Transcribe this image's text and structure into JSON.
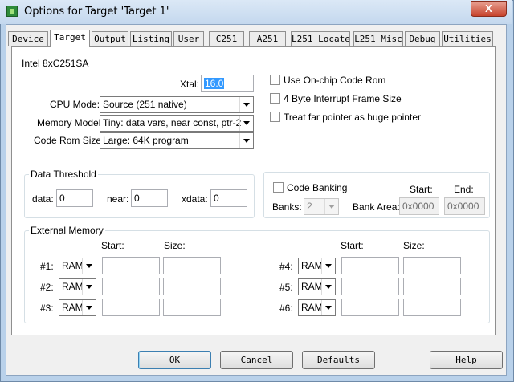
{
  "window": {
    "title": "Options for Target 'Target 1'",
    "close_glyph": "X"
  },
  "tabs": [
    {
      "label": "Device"
    },
    {
      "label": "Target"
    },
    {
      "label": "Output"
    },
    {
      "label": "Listing"
    },
    {
      "label": "User"
    },
    {
      "label": "C251"
    },
    {
      "label": "A251"
    },
    {
      "label": "L251 Locate"
    },
    {
      "label": "L251 Misc"
    },
    {
      "label": "Debug"
    },
    {
      "label": "Utilities"
    }
  ],
  "active_tab": "Target",
  "device_name": "Intel 8xC251SA",
  "xtal": {
    "label": "Xtal:",
    "value": "16.0"
  },
  "cpu_mode": {
    "label": "CPU Mode:",
    "value": "Source (251 native)"
  },
  "memory_model": {
    "label": "Memory Model:",
    "value": "Tiny: data vars, near const, ptr-2"
  },
  "code_rom_size": {
    "label": "Code Rom Size:",
    "value": "Large: 64K program"
  },
  "options": [
    {
      "label": "Use On-chip Code Rom",
      "checked": false
    },
    {
      "label": "4 Byte Interrupt Frame Size",
      "checked": false
    },
    {
      "label": "Treat far pointer as huge pointer",
      "checked": false
    }
  ],
  "data_threshold": {
    "title": "Data Threshold",
    "data_label": "data:",
    "data_value": "0",
    "near_label": "near:",
    "near_value": "0",
    "xdata_label": "xdata:",
    "xdata_value": "0"
  },
  "code_banking": {
    "label": "Code Banking",
    "checked": false,
    "banks_label": "Banks:",
    "banks_value": "2",
    "bank_area_label": "Bank Area:",
    "start_label": "Start:",
    "start_value": "0x0000",
    "end_label": "End:",
    "end_value": "0x0000"
  },
  "external_memory": {
    "title": "External Memory",
    "start_label": "Start:",
    "size_label": "Size:",
    "rows": [
      {
        "label": "#1:",
        "type": "RAM",
        "start": "",
        "size": ""
      },
      {
        "label": "#2:",
        "type": "RAM",
        "start": "",
        "size": ""
      },
      {
        "label": "#3:",
        "type": "RAM",
        "start": "",
        "size": ""
      },
      {
        "label": "#4:",
        "type": "RAM",
        "start": "",
        "size": ""
      },
      {
        "label": "#5:",
        "type": "RAM",
        "start": "",
        "size": ""
      },
      {
        "label": "#6:",
        "type": "RAM",
        "start": "",
        "size": ""
      }
    ]
  },
  "buttons": {
    "ok": "OK",
    "cancel": "Cancel",
    "defaults": "Defaults",
    "help": "Help"
  }
}
